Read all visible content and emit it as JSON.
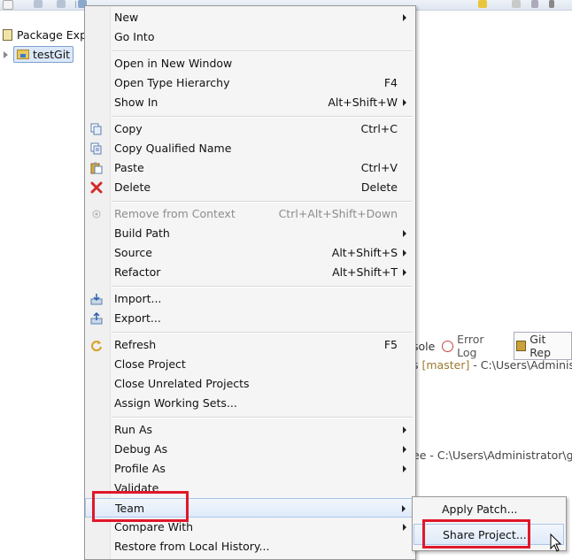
{
  "package_explorer": {
    "tab_title": "Package Exp",
    "project_name": "testGit"
  },
  "background_views": {
    "console_tab_fragment": "sole",
    "error_log_tab": "Error Log",
    "git_tab_fragment": "Git Rep",
    "repo_line_prefix": "s ",
    "repo_line_branch": "[master]",
    "repo_line_path": " - C:\\Users\\Administ",
    "tree_line": "ee - C:\\Users\\Administrator\\git"
  },
  "context_menu": {
    "items": [
      {
        "label": "New",
        "submenu": true
      },
      {
        "label": "Go Into"
      },
      {
        "label": "Open in New Window"
      },
      {
        "label": "Open Type Hierarchy",
        "accelerator": "F4"
      },
      {
        "label": "Show In",
        "accelerator": "Alt+Shift+W",
        "submenu": true
      },
      {
        "label": "Copy",
        "accelerator": "Ctrl+C",
        "icon": "copy-icon"
      },
      {
        "label": "Copy Qualified Name",
        "icon": "copy-qualified-name-icon"
      },
      {
        "label": "Paste",
        "accelerator": "Ctrl+V",
        "icon": "paste-icon"
      },
      {
        "label": "Delete",
        "accelerator": "Delete",
        "icon": "delete-icon"
      },
      {
        "label": "Remove from Context",
        "accelerator": "Ctrl+Alt+Shift+Down",
        "disabled": true,
        "icon": "remove-from-context-icon"
      },
      {
        "label": "Build Path",
        "submenu": true
      },
      {
        "label": "Source",
        "accelerator": "Alt+Shift+S",
        "submenu": true
      },
      {
        "label": "Refactor",
        "accelerator": "Alt+Shift+T",
        "submenu": true
      },
      {
        "label": "Import...",
        "icon": "import-icon"
      },
      {
        "label": "Export...",
        "icon": "export-icon"
      },
      {
        "label": "Refresh",
        "accelerator": "F5",
        "icon": "refresh-icon"
      },
      {
        "label": "Close Project"
      },
      {
        "label": "Close Unrelated Projects"
      },
      {
        "label": "Assign Working Sets..."
      },
      {
        "label": "Run As",
        "submenu": true
      },
      {
        "label": "Debug As",
        "submenu": true
      },
      {
        "label": "Profile As",
        "submenu": true
      },
      {
        "label": "Validate"
      },
      {
        "label": "Team",
        "submenu": true,
        "highlighted": true
      },
      {
        "label": "Compare With",
        "submenu": true
      },
      {
        "label": "Restore from Local History..."
      }
    ]
  },
  "team_submenu": {
    "items": [
      {
        "label": "Apply Patch..."
      },
      {
        "label": "Share Project...",
        "highlighted": true
      }
    ]
  },
  "colors": {
    "highlight_box": "#e0182a",
    "menu_background": "#f5f5f5",
    "disabled_text": "#8d8d8d"
  }
}
